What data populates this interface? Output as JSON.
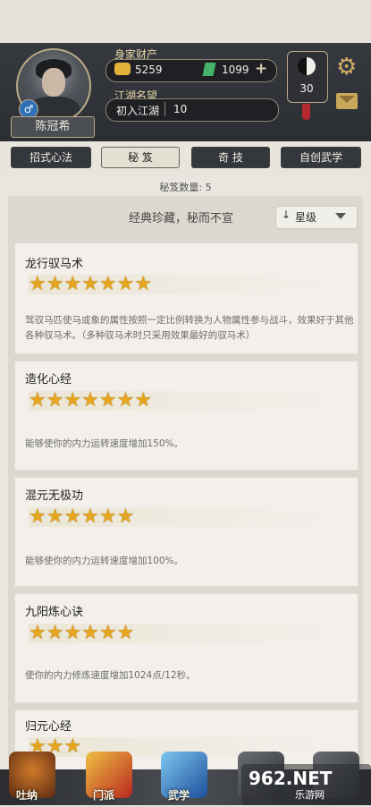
{
  "player": {
    "name": "陈冠希",
    "gender_icon": "male-icon"
  },
  "wealth": {
    "label": "身家财产",
    "gold": "5259",
    "jade": "1099",
    "add_label": "+"
  },
  "fame": {
    "label": "江湖名望",
    "rank": "初入江湖",
    "level": "10"
  },
  "badge": {
    "level": "30"
  },
  "tabs": [
    {
      "label": "招式心法",
      "active": false
    },
    {
      "label": "秘 笈",
      "active": true
    },
    {
      "label": "奇 技",
      "active": false
    },
    {
      "label": "自创武学",
      "active": false
    }
  ],
  "count_label": "秘笈数量: 5",
  "panel": {
    "header": "经典珍藏，秘而不宣",
    "sort_label": "星级",
    "sort_arrow": "↓"
  },
  "skills": [
    {
      "name": "龙行驭马术",
      "stars": 7,
      "description": "驾驭马匹使马或象的属性按照一定比例转换为人物属性参与战斗，效果好于其他各种驭马术。（多种驭马术时只采用效果最好的驭马术）"
    },
    {
      "name": "造化心经",
      "stars": 7,
      "description": "能够使你的内力运转速度增加150%。"
    },
    {
      "name": "混元无极功",
      "stars": 6,
      "description": "能够使你的内力运转速度增加100%。"
    },
    {
      "name": "九阳炼心诀",
      "stars": 6,
      "description": "使你的内力修炼速度增加1024点/12秒。"
    },
    {
      "name": "归元心经",
      "stars": 3,
      "description": ""
    }
  ],
  "nav": [
    {
      "label": "吐纳"
    },
    {
      "label": "门派"
    },
    {
      "label": "武学"
    },
    {
      "label": ""
    },
    {
      "label": ""
    }
  ],
  "watermark": {
    "text": "962.NET",
    "sub": "乐游网"
  },
  "colors": {
    "star": "#e5a51f",
    "header_bg": "#2b2e33",
    "accent_gold": "#d4b067"
  }
}
